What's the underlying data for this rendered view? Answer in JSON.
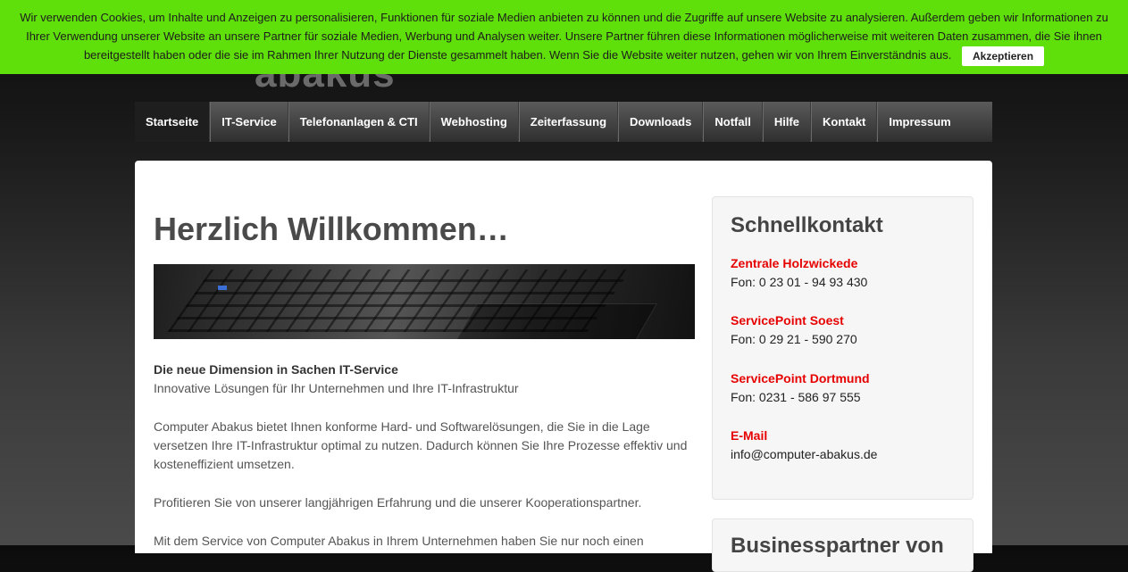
{
  "cookie": {
    "text": "Wir verwenden Cookies, um Inhalte und Anzeigen zu personalisieren, Funktionen für soziale Medien anbieten zu können und die Zugriffe auf unsere Website zu analysieren. Außerdem geben wir Informationen zu Ihrer Verwendung unserer Website an unsere Partner für soziale Medien, Werbung und Analysen weiter. Unsere Partner führen diese Informationen möglicherweise mit weiteren Daten zusammen, die Sie ihnen bereitgestellt haben oder die sie im Rahmen Ihrer Nutzung der Dienste gesammelt haben. Wenn Sie die Website weiter nutzen, gehen wir von Ihrem Einverständnis aus.",
    "accept_label": "Akzeptieren",
    "bg_color": "#5fe00b"
  },
  "logo": {
    "text": "abakus"
  },
  "nav": {
    "items": [
      {
        "label": "Startseite",
        "active": true
      },
      {
        "label": "IT-Service"
      },
      {
        "label": "Telefonanlagen & CTI"
      },
      {
        "label": "Webhosting"
      },
      {
        "label": "Zeiterfassung"
      },
      {
        "label": "Downloads"
      },
      {
        "label": "Notfall"
      },
      {
        "label": "Hilfe"
      },
      {
        "label": "Kontakt"
      },
      {
        "label": "Impressum"
      }
    ]
  },
  "main": {
    "title": "Herzlich Willkommen…",
    "subtitle": "Die neue Dimension in Sachen IT-Service",
    "tagline": "Innovative Lösungen für Ihr Unternehmen und Ihre IT-Infrastruktur",
    "para1": "Computer Abakus bietet Ihnen konforme Hard- und Softwarelösungen, die Sie in die Lage versetzen Ihre IT-Infrastruktur optimal zu nutzen. Dadurch können Sie Ihre Prozesse effektiv und kosteneffizient umsetzen.",
    "para2": "Profitieren Sie von unserer langjährigen Erfahrung und die unserer Kooperationspartner.",
    "para3": "Mit dem Service von Computer Abakus in Ihrem Unternehmen haben Sie nur noch einen"
  },
  "side": {
    "title": "Schnellkontakt",
    "locations": [
      {
        "name": "Zentrale Holzwickede",
        "value": "Fon: 0 23 01 - 94 93 430"
      },
      {
        "name": "ServicePoint Soest",
        "value": "Fon: 0 29 21 - 590 270"
      },
      {
        "name": "ServicePoint Dortmund",
        "value": "Fon: 0231 - 586 97 555"
      },
      {
        "name": "E-Mail",
        "value": "info@computer-abakus.de"
      }
    ],
    "title2": "Businesspartner von",
    "accent_color": "#e60000"
  }
}
